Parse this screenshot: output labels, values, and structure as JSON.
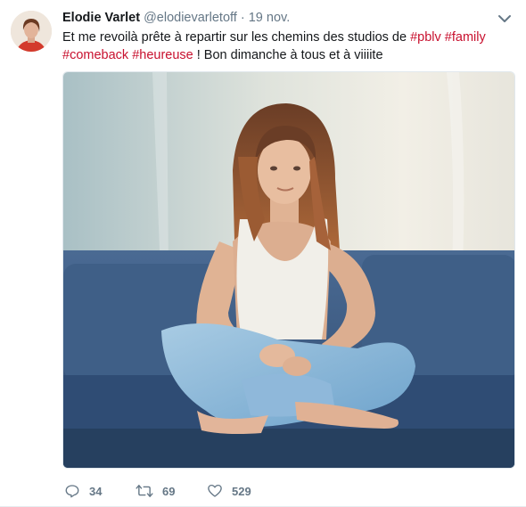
{
  "tweet": {
    "author_name": "Elodie Varlet",
    "handle": "@elodievarletoff",
    "separator": "·",
    "date": "19 nov.",
    "text_before": "Et me revoilà prête à repartir sur les chemins des studios de ",
    "hashtags": [
      "#pblv",
      "#family",
      "#comeback",
      "#heureuse"
    ],
    "text_after": " ! Bon dimanche à tous et à viiiite",
    "icons": {
      "caret": "chevron-down-icon",
      "reply": "reply-icon",
      "retweet": "retweet-icon",
      "like": "heart-icon"
    }
  },
  "actions": {
    "replies": "34",
    "retweets": "69",
    "likes": "529"
  },
  "colors": {
    "hashtag": "#c8102e",
    "muted": "#657786",
    "sofa": "#3c5a80"
  }
}
